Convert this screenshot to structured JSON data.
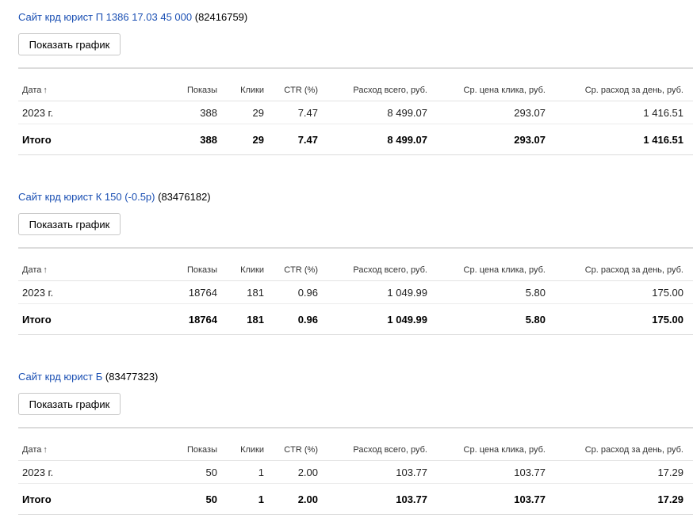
{
  "columns": {
    "date": "Дата",
    "sort_arrow": "↑",
    "impressions": "Показы",
    "clicks": "Клики",
    "ctr": "CTR (%)",
    "cost": "Расход всего, руб.",
    "cpc": "Ср. цена клика, руб.",
    "daily": "Ср. расход за день, руб."
  },
  "campaigns": [
    {
      "name": "Сайт крд юрист П 1386 17.03 45 000",
      "id": "(82416759)",
      "button": "Показать график",
      "rows": [
        {
          "date": "2023 г.",
          "impressions": "388",
          "clicks": "29",
          "ctr": "7.47",
          "cost": "8 499.07",
          "cpc": "293.07",
          "daily": "1 416.51"
        }
      ],
      "total": {
        "label": "Итого",
        "impressions": "388",
        "clicks": "29",
        "ctr": "7.47",
        "cost": "8 499.07",
        "cpc": "293.07",
        "daily": "1 416.51"
      }
    },
    {
      "name": "Сайт крд юрист К 150 (-0.5р)",
      "id": "(83476182)",
      "button": "Показать график",
      "rows": [
        {
          "date": "2023 г.",
          "impressions": "18764",
          "clicks": "181",
          "ctr": "0.96",
          "cost": "1 049.99",
          "cpc": "5.80",
          "daily": "175.00"
        }
      ],
      "total": {
        "label": "Итого",
        "impressions": "18764",
        "clicks": "181",
        "ctr": "0.96",
        "cost": "1 049.99",
        "cpc": "5.80",
        "daily": "175.00"
      }
    },
    {
      "name": "Сайт крд юрист Б",
      "id": "(83477323)",
      "button": "Показать график",
      "rows": [
        {
          "date": "2023 г.",
          "impressions": "50",
          "clicks": "1",
          "ctr": "2.00",
          "cost": "103.77",
          "cpc": "103.77",
          "daily": "17.29"
        }
      ],
      "total": {
        "label": "Итого",
        "impressions": "50",
        "clicks": "1",
        "ctr": "2.00",
        "cost": "103.77",
        "cpc": "103.77",
        "daily": "17.29"
      }
    }
  ]
}
